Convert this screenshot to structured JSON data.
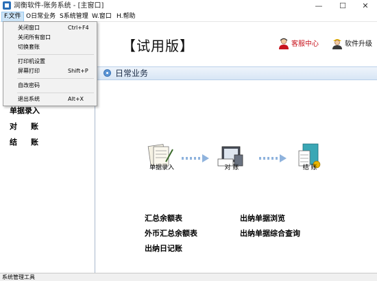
{
  "window": {
    "title": "润衡软件-账务系统 - [主窗口]",
    "controls": {
      "minimize": "—",
      "maximize": "☐",
      "close": "✕"
    }
  },
  "menubar": {
    "items": [
      {
        "label": "F.文件",
        "active": true
      },
      {
        "label": "O日常业务"
      },
      {
        "label": "S系统管理"
      },
      {
        "label": "W.窗口"
      },
      {
        "label": "H.帮助"
      }
    ]
  },
  "file_menu": {
    "items": [
      {
        "label": "关闭窗口",
        "shortcut": "Ctrl+F4"
      },
      {
        "label": "关闭所有窗口",
        "shortcut": ""
      },
      {
        "label": "切换套账",
        "shortcut": ""
      },
      {
        "label": "打印机设置",
        "shortcut": ""
      },
      {
        "label": "屏幕打印",
        "shortcut": "Shift+P"
      },
      {
        "label": "自改密码",
        "shortcut": ""
      },
      {
        "label": "退出系统",
        "shortcut": "Alt+X"
      }
    ]
  },
  "header": {
    "trial_label": "【试用版】",
    "service_label": "客服中心",
    "upgrade_label": "软件升级"
  },
  "section": {
    "title": "日常业务"
  },
  "left_panel": {
    "items": [
      "单据录入",
      "对账",
      "结账"
    ]
  },
  "workflow": {
    "steps": [
      "单据录入",
      "对 账",
      "结 账"
    ]
  },
  "reports": {
    "col1": [
      "汇总余额表",
      "外币汇总余额表",
      "出纳日记账"
    ],
    "col2": [
      "出纳单据浏览",
      "出纳单据综合查询"
    ]
  },
  "status_bar": {
    "text": "系统管理工具"
  },
  "colors": {
    "service_text": "#c8141e",
    "section_bar": "#d8e6f5",
    "menu_active": "#cce4f7",
    "arrow": "#8fb3dd"
  }
}
